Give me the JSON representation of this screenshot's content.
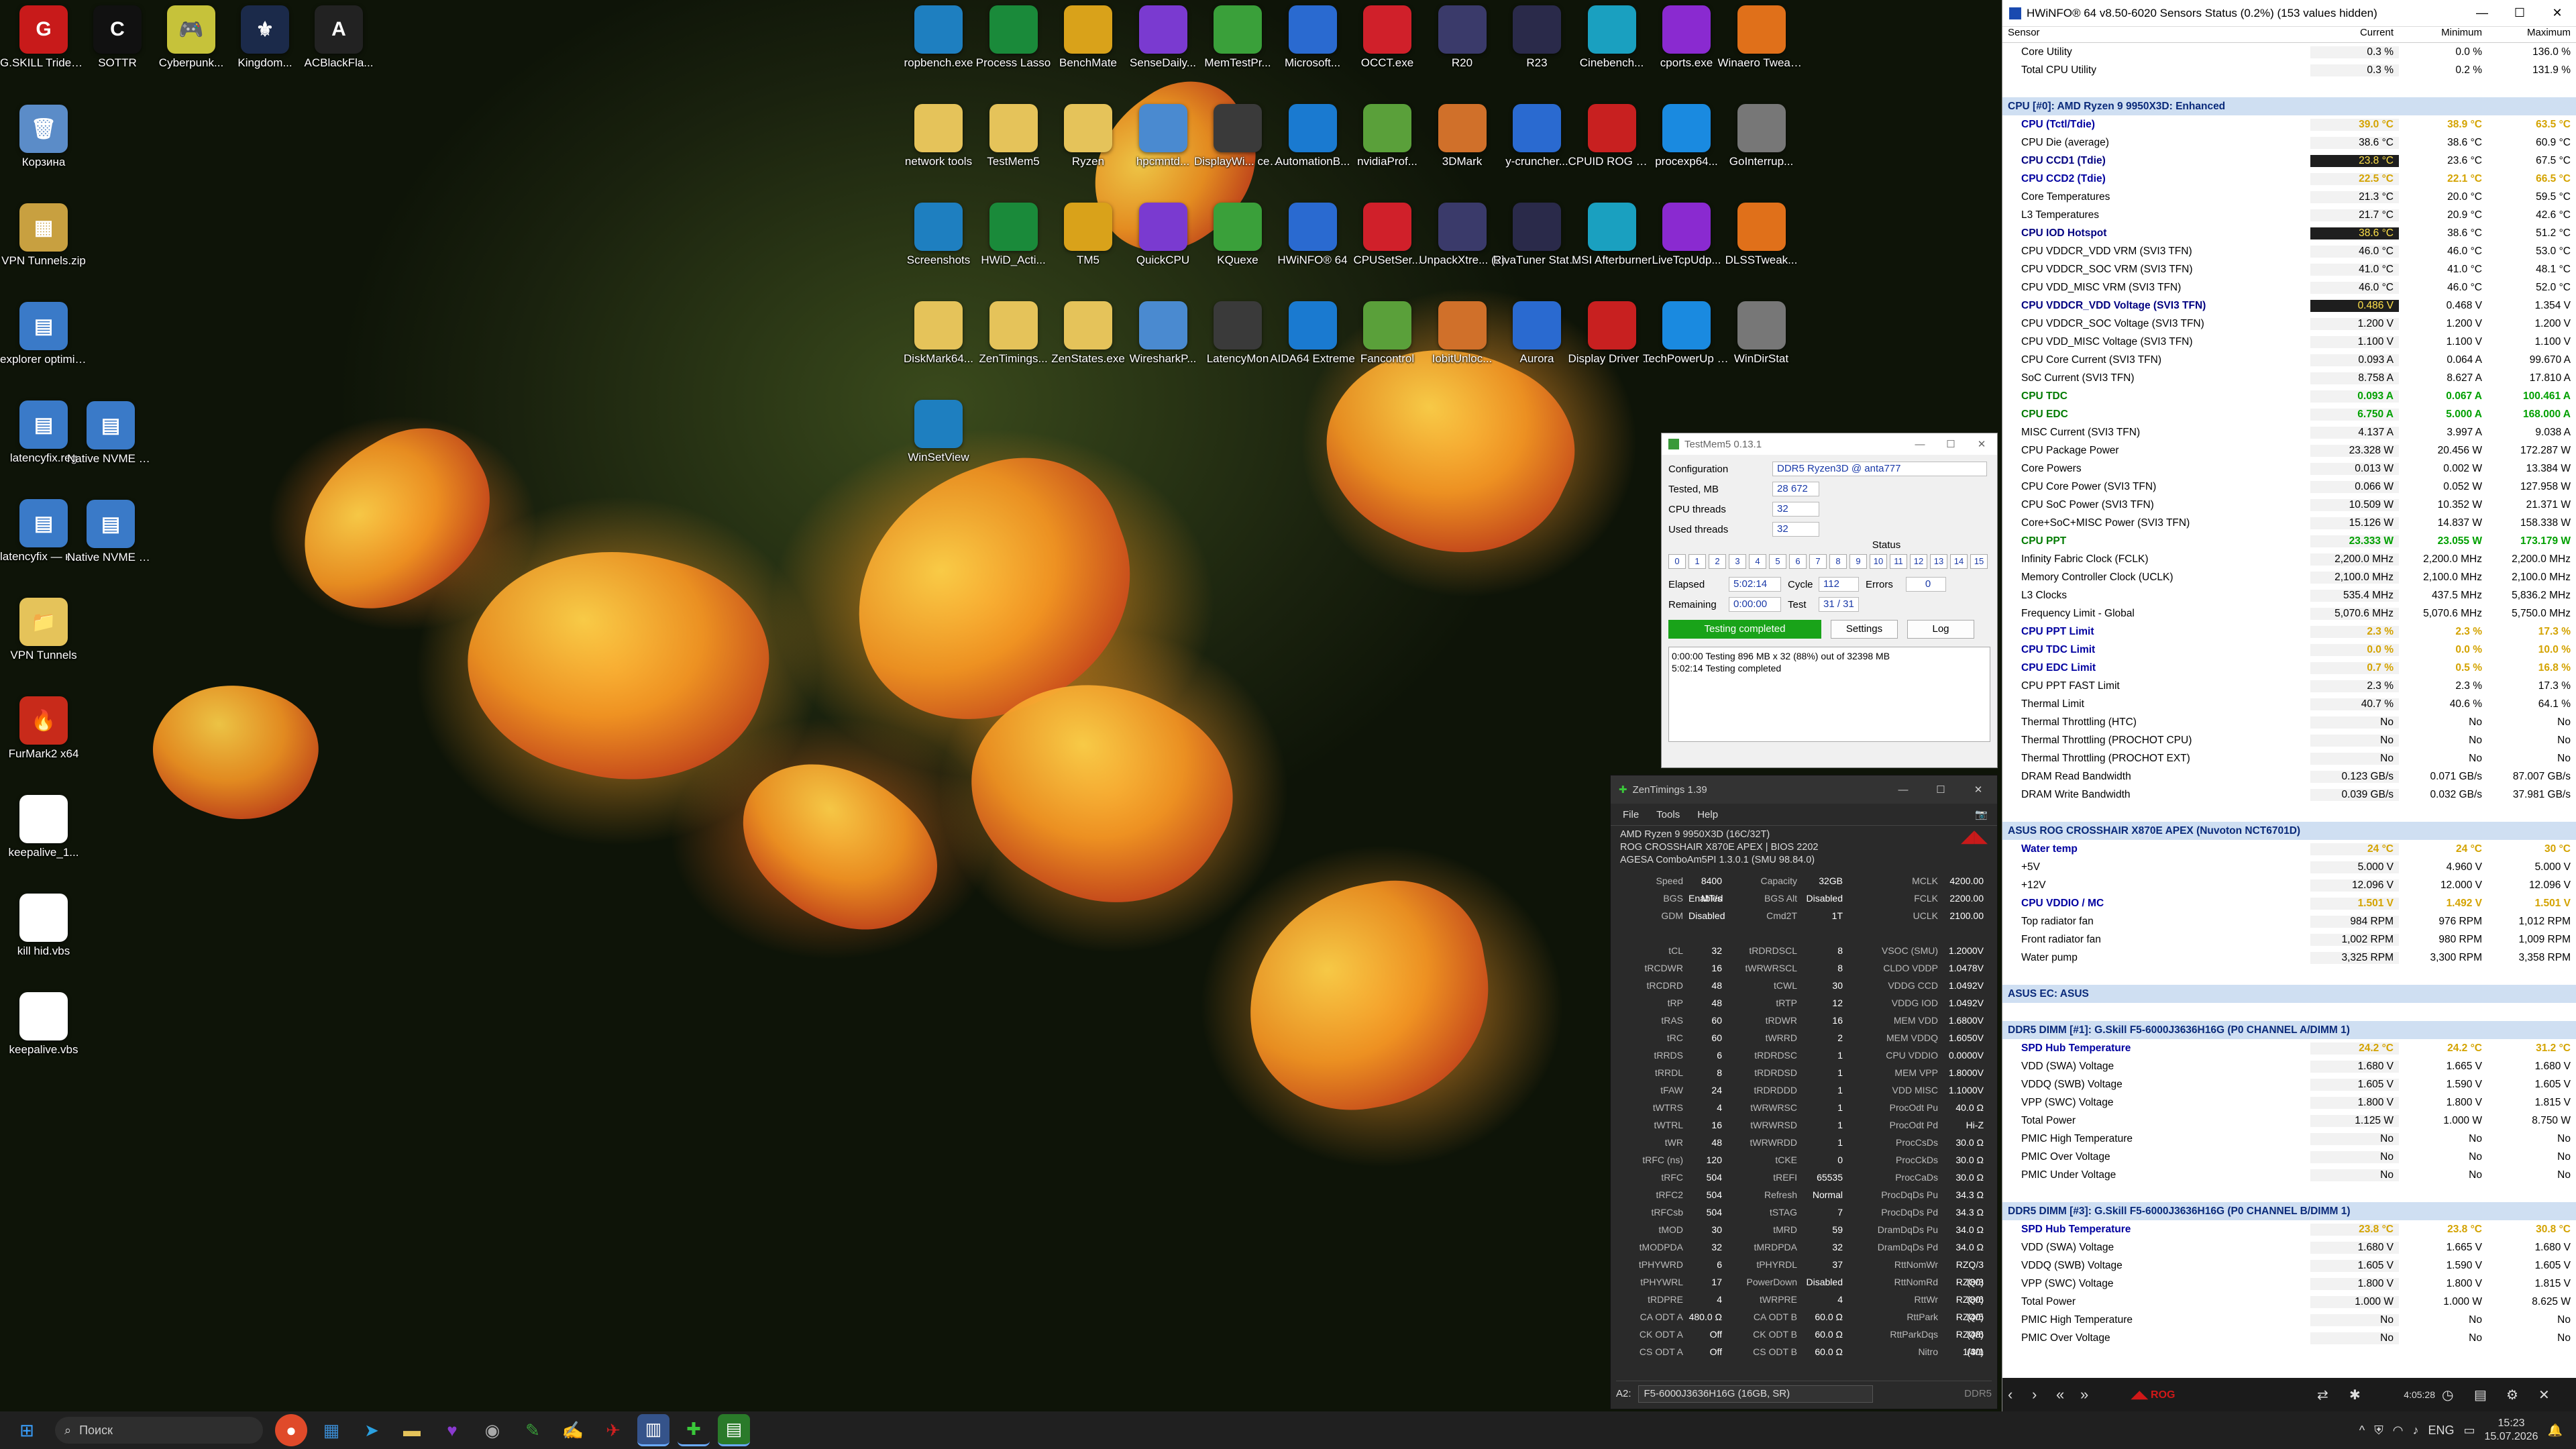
{
  "desktop": {
    "left_icons": [
      {
        "label": "G.SKILL Trident...",
        "glyph": "G",
        "color": "#c81a1a"
      },
      {
        "label": "SOTTR",
        "glyph": "C",
        "color": "#111"
      },
      {
        "label": "Cyberpunk...",
        "glyph": "🎮",
        "color": "#c6c23a"
      },
      {
        "label": "Kingdom...",
        "glyph": "⚜",
        "color": "#1b2a4a"
      },
      {
        "label": "ACBlackFla...",
        "glyph": "A",
        "color": "#222"
      }
    ],
    "col_icons": [
      {
        "label": "Корзина",
        "glyph": "🗑",
        "color": "#5b8cc8"
      },
      {
        "label": "VPN Tunnels.zip",
        "glyph": "▦",
        "color": "#c8a040"
      },
      {
        "label": "explorer optimizatio...",
        "glyph": "▤",
        "color": "#3a7ac8"
      },
      {
        "label": "latencyfix.reg",
        "glyph": "▤",
        "color": "#3a7ac8"
      },
      {
        "label": "latencyfix — копия.reg",
        "glyph": "▤",
        "color": "#3a7ac8"
      },
      {
        "label": "VPN Tunnels",
        "glyph": "📁",
        "color": "#e5c35a"
      },
      {
        "label": "FurMark2 x64",
        "glyph": "🔥",
        "color": "#c82a1a"
      },
      {
        "label": "keepalive_1...",
        "glyph": "S",
        "color": "#ffffff"
      },
      {
        "label": "kill hid.vbs",
        "glyph": "S",
        "color": "#ffffff"
      },
      {
        "label": "keepalive.vbs",
        "glyph": "S",
        "color": "#ffffff"
      }
    ],
    "col2_icons": [
      {
        "label": "Native NVME support — ...",
        "glyph": "▤",
        "color": "#3a7ac8"
      },
      {
        "label": "Native NVME support.reg",
        "glyph": "▤",
        "color": "#3a7ac8"
      }
    ],
    "grid_icons": [
      [
        "ropbench.exe",
        "Process Lasso",
        "BenchMate",
        "SenseDaily...",
        "MemTestPr...",
        "Microsoft...",
        "OCCT.exe",
        "R20",
        "R23",
        "Cinebench...",
        "cports.exe",
        "Winaero Tweaker"
      ],
      [
        "network tools",
        "TestMem5",
        "Ryzen",
        "hpcmntd...",
        "DisplayWi... center",
        "AutomationB...",
        "nvidiaProf...",
        "3DMark",
        "y-cruncher...",
        "CPUID ROG CPU-Z",
        "procexp64...",
        "GoInterrup..."
      ],
      [
        "Screenshots",
        "HWiD_Acti...",
        "TM5",
        "QuickCPU",
        "KQuexe",
        "HWiNFO® 64",
        "CPUSetSer...",
        "UnpackXtre... (2)",
        "RivaTuner Statistic...",
        "MSI Afterburner",
        "LiveTcpUdp...",
        "DLSSTweak..."
      ],
      [
        "DiskMark64...",
        "ZenTimings...",
        "ZenStates.exe",
        "WiresharkP...",
        "LatencyMon",
        "AIDA64 Extreme",
        "Fancontrol",
        "IobitUnloc...",
        "Aurora",
        "Display Driver U...",
        "TechPowerUp GPU-Z",
        "WinDirStat"
      ],
      [
        "WinSetView"
      ]
    ],
    "grid_colors": [
      "#1e7fc0",
      "#1a8a3a",
      "#d9a21a",
      "#7a3ad0",
      "#3aa03a",
      "#2a6ad0",
      "#d0202a",
      "#3a3a6a",
      "#2a2a4a",
      "#1aa0c0",
      "#8a2ad0",
      "#e0701a",
      "#e5c35a",
      "#e5c35a",
      "#e5c35a",
      "#4a8ad0",
      "#3a3a3a",
      "#1a7ad0",
      "#5aa03a",
      "#d0702a",
      "#2a6ad0",
      "#c82020",
      "#1a8ae0",
      "#777"
    ]
  },
  "hwinfo": {
    "title": "HWiNFO® 64 v8.50-6020 Sensors Status (0.2%) (153 values hidden)",
    "headers": [
      "Sensor",
      "Current",
      "Minimum",
      "Maximum"
    ],
    "rows": [
      {
        "t": "",
        "n": "Core Utility",
        "c": "0.3 %",
        "mi": "0.0 %",
        "ma": "136.0 %"
      },
      {
        "t": "",
        "n": "Total CPU Utility",
        "c": "0.3 %",
        "mi": "0.2 %",
        "ma": "131.9 %"
      },
      {
        "t": "blank",
        "n": "",
        "c": "",
        "mi": "",
        "ma": ""
      },
      {
        "t": "grp",
        "n": "CPU [#0]: AMD Ryzen 9 9950X3D: Enhanced",
        "c": "",
        "mi": "",
        "ma": ""
      },
      {
        "t": "yl",
        "n": "CPU (Tctl/Tdie)",
        "c": "39.0 °C",
        "mi": "38.9 °C",
        "ma": "63.5 °C"
      },
      {
        "t": "",
        "n": "CPU Die (average)",
        "c": "38.6 °C",
        "mi": "38.6 °C",
        "ma": "60.9 °C"
      },
      {
        "t": "hl",
        "n": "CPU CCD1 (Tdie)",
        "c": "23.8 °C",
        "mi": "23.6 °C",
        "ma": "67.5 °C"
      },
      {
        "t": "yl",
        "n": "CPU CCD2 (Tdie)",
        "c": "22.5 °C",
        "mi": "22.1 °C",
        "ma": "66.5 °C"
      },
      {
        "t": "",
        "n": "Core Temperatures",
        "c": "21.3 °C",
        "mi": "20.0 °C",
        "ma": "59.5 °C"
      },
      {
        "t": "",
        "n": "L3 Temperatures",
        "c": "21.7 °C",
        "mi": "20.9 °C",
        "ma": "42.6 °C"
      },
      {
        "t": "hl",
        "n": "CPU IOD Hotspot",
        "c": "38.6 °C",
        "mi": "38.6 °C",
        "ma": "51.2 °C"
      },
      {
        "t": "",
        "n": "CPU VDDCR_VDD VRM (SVI3 TFN)",
        "c": "46.0 °C",
        "mi": "46.0 °C",
        "ma": "53.0 °C"
      },
      {
        "t": "",
        "n": "CPU VDDCR_SOC VRM (SVI3 TFN)",
        "c": "41.0 °C",
        "mi": "41.0 °C",
        "ma": "48.1 °C"
      },
      {
        "t": "",
        "n": "CPU VDD_MISC VRM (SVI3 TFN)",
        "c": "46.0 °C",
        "mi": "46.0 °C",
        "ma": "52.0 °C"
      },
      {
        "t": "hl",
        "n": "CPU VDDCR_VDD Voltage (SVI3 TFN)",
        "c": "0.486 V",
        "mi": "0.468 V",
        "ma": "1.354 V"
      },
      {
        "t": "",
        "n": "CPU VDDCR_SOC Voltage (SVI3 TFN)",
        "c": "1.200 V",
        "mi": "1.200 V",
        "ma": "1.200 V"
      },
      {
        "t": "",
        "n": "CPU VDD_MISC Voltage (SVI3 TFN)",
        "c": "1.100 V",
        "mi": "1.100 V",
        "ma": "1.100 V"
      },
      {
        "t": "",
        "n": "CPU Core Current (SVI3 TFN)",
        "c": "0.093 A",
        "mi": "0.064 A",
        "ma": "99.670 A"
      },
      {
        "t": "",
        "n": "SoC Current (SVI3 TFN)",
        "c": "8.758 A",
        "mi": "8.627 A",
        "ma": "17.810 A"
      },
      {
        "t": "gr",
        "n": "CPU TDC",
        "c": "0.093 A",
        "mi": "0.067 A",
        "ma": "100.461 A"
      },
      {
        "t": "gr",
        "n": "CPU EDC",
        "c": "6.750 A",
        "mi": "5.000 A",
        "ma": "168.000 A"
      },
      {
        "t": "",
        "n": "MISC Current (SVI3 TFN)",
        "c": "4.137 A",
        "mi": "3.997 A",
        "ma": "9.038 A"
      },
      {
        "t": "",
        "n": "CPU Package Power",
        "c": "23.328 W",
        "mi": "20.456 W",
        "ma": "172.287 W"
      },
      {
        "t": "",
        "n": "Core Powers",
        "c": "0.013 W",
        "mi": "0.002 W",
        "ma": "13.384 W"
      },
      {
        "t": "",
        "n": "CPU Core Power (SVI3 TFN)",
        "c": "0.066 W",
        "mi": "0.052 W",
        "ma": "127.958 W"
      },
      {
        "t": "",
        "n": "CPU SoC Power (SVI3 TFN)",
        "c": "10.509 W",
        "mi": "10.352 W",
        "ma": "21.371 W"
      },
      {
        "t": "",
        "n": "Core+SoC+MISC Power (SVI3 TFN)",
        "c": "15.126 W",
        "mi": "14.837 W",
        "ma": "158.338 W"
      },
      {
        "t": "gr",
        "n": "CPU PPT",
        "c": "23.333 W",
        "mi": "23.055 W",
        "ma": "173.179 W"
      },
      {
        "t": "",
        "n": "Infinity Fabric Clock (FCLK)",
        "c": "2,200.0 MHz",
        "mi": "2,200.0 MHz",
        "ma": "2,200.0 MHz"
      },
      {
        "t": "",
        "n": "Memory Controller Clock (UCLK)",
        "c": "2,100.0 MHz",
        "mi": "2,100.0 MHz",
        "ma": "2,100.0 MHz"
      },
      {
        "t": "",
        "n": "L3 Clocks",
        "c": "535.4 MHz",
        "mi": "437.5 MHz",
        "ma": "5,836.2 MHz"
      },
      {
        "t": "",
        "n": "Frequency Limit - Global",
        "c": "5,070.6 MHz",
        "mi": "5,070.6 MHz",
        "ma": "5,750.0 MHz"
      },
      {
        "t": "yl",
        "n": "CPU PPT Limit",
        "c": "2.3 %",
        "mi": "2.3 %",
        "ma": "17.3 %"
      },
      {
        "t": "yl",
        "n": "CPU TDC Limit",
        "c": "0.0 %",
        "mi": "0.0 %",
        "ma": "10.0 %"
      },
      {
        "t": "yl",
        "n": "CPU EDC Limit",
        "c": "0.7 %",
        "mi": "0.5 %",
        "ma": "16.8 %"
      },
      {
        "t": "",
        "n": "CPU PPT FAST Limit",
        "c": "2.3 %",
        "mi": "2.3 %",
        "ma": "17.3 %"
      },
      {
        "t": "",
        "n": "Thermal Limit",
        "c": "40.7 %",
        "mi": "40.6 %",
        "ma": "64.1 %"
      },
      {
        "t": "",
        "n": "Thermal Throttling (HTC)",
        "c": "No",
        "mi": "No",
        "ma": "No"
      },
      {
        "t": "",
        "n": "Thermal Throttling (PROCHOT CPU)",
        "c": "No",
        "mi": "No",
        "ma": "No"
      },
      {
        "t": "",
        "n": "Thermal Throttling (PROCHOT EXT)",
        "c": "No",
        "mi": "No",
        "ma": "No"
      },
      {
        "t": "",
        "n": "DRAM Read Bandwidth",
        "c": "0.123 GB/s",
        "mi": "0.071 GB/s",
        "ma": "87.007 GB/s"
      },
      {
        "t": "",
        "n": "DRAM Write Bandwidth",
        "c": "0.039 GB/s",
        "mi": "0.032 GB/s",
        "ma": "37.981 GB/s"
      },
      {
        "t": "blank",
        "n": "",
        "c": "",
        "mi": "",
        "ma": ""
      },
      {
        "t": "grp",
        "n": "ASUS ROG CROSSHAIR X870E APEX (Nuvoton NCT6701D)",
        "c": "",
        "mi": "",
        "ma": ""
      },
      {
        "t": "yl",
        "n": "Water temp",
        "c": "24 °C",
        "mi": "24 °C",
        "ma": "30 °C"
      },
      {
        "t": "",
        "n": "+5V",
        "c": "5.000 V",
        "mi": "4.960 V",
        "ma": "5.000 V"
      },
      {
        "t": "",
        "n": "+12V",
        "c": "12.096 V",
        "mi": "12.000 V",
        "ma": "12.096 V"
      },
      {
        "t": "yl",
        "n": "CPU VDDIO / MC",
        "c": "1.501 V",
        "mi": "1.492 V",
        "ma": "1.501 V"
      },
      {
        "t": "",
        "n": "Top radiator fan",
        "c": "984 RPM",
        "mi": "976 RPM",
        "ma": "1,012 RPM"
      },
      {
        "t": "",
        "n": "Front radiator fan",
        "c": "1,002 RPM",
        "mi": "980 RPM",
        "ma": "1,009 RPM"
      },
      {
        "t": "",
        "n": "Water pump",
        "c": "3,325 RPM",
        "mi": "3,300 RPM",
        "ma": "3,358 RPM"
      },
      {
        "t": "blank",
        "n": "",
        "c": "",
        "mi": "",
        "ma": ""
      },
      {
        "t": "grp",
        "n": "ASUS EC: ASUS",
        "c": "",
        "mi": "",
        "ma": ""
      },
      {
        "t": "blank",
        "n": "",
        "c": "",
        "mi": "",
        "ma": ""
      },
      {
        "t": "grp",
        "n": "DDR5 DIMM [#1]: G.Skill F5-6000J3636H16G (P0 CHANNEL A/DIMM 1)",
        "c": "",
        "mi": "",
        "ma": ""
      },
      {
        "t": "yl",
        "n": "SPD Hub Temperature",
        "c": "24.2 °C",
        "mi": "24.2 °C",
        "ma": "31.2 °C"
      },
      {
        "t": "",
        "n": "VDD (SWA) Voltage",
        "c": "1.680 V",
        "mi": "1.665 V",
        "ma": "1.680 V"
      },
      {
        "t": "",
        "n": "VDDQ (SWB) Voltage",
        "c": "1.605 V",
        "mi": "1.590 V",
        "ma": "1.605 V"
      },
      {
        "t": "",
        "n": "VPP (SWC) Voltage",
        "c": "1.800 V",
        "mi": "1.800 V",
        "ma": "1.815 V"
      },
      {
        "t": "",
        "n": "Total Power",
        "c": "1.125 W",
        "mi": "1.000 W",
        "ma": "8.750 W"
      },
      {
        "t": "",
        "n": "PMIC High Temperature",
        "c": "No",
        "mi": "No",
        "ma": "No"
      },
      {
        "t": "",
        "n": "PMIC Over Voltage",
        "c": "No",
        "mi": "No",
        "ma": "No"
      },
      {
        "t": "",
        "n": "PMIC Under Voltage",
        "c": "No",
        "mi": "No",
        "ma": "No"
      },
      {
        "t": "blank",
        "n": "",
        "c": "",
        "mi": "",
        "ma": ""
      },
      {
        "t": "grp",
        "n": "DDR5 DIMM [#3]: G.Skill F5-6000J3636H16G (P0 CHANNEL B/DIMM 1)",
        "c": "",
        "mi": "",
        "ma": ""
      },
      {
        "t": "yl",
        "n": "SPD Hub Temperature",
        "c": "23.8 °C",
        "mi": "23.8 °C",
        "ma": "30.8 °C"
      },
      {
        "t": "",
        "n": "VDD (SWA) Voltage",
        "c": "1.680 V",
        "mi": "1.665 V",
        "ma": "1.680 V"
      },
      {
        "t": "",
        "n": "VDDQ (SWB) Voltage",
        "c": "1.605 V",
        "mi": "1.590 V",
        "ma": "1.605 V"
      },
      {
        "t": "",
        "n": "VPP (SWC) Voltage",
        "c": "1.800 V",
        "mi": "1.800 V",
        "ma": "1.815 V"
      },
      {
        "t": "",
        "n": "Total Power",
        "c": "1.000 W",
        "mi": "1.000 W",
        "ma": "8.625 W"
      },
      {
        "t": "",
        "n": "PMIC High Temperature",
        "c": "No",
        "mi": "No",
        "ma": "No"
      },
      {
        "t": "",
        "n": "PMIC Over Voltage",
        "c": "No",
        "mi": "No",
        "ma": "No"
      }
    ],
    "footer_time": "4:05:28"
  },
  "testmem": {
    "title": "TestMem5  0.13.1",
    "config_label": "Configuration",
    "config": "DDR5 Ryzen3D @ anta777",
    "tested_label": "Tested, MB",
    "tested": "28 672",
    "cpu_label": "CPU threads",
    "cpu": "32",
    "used_label": "Used threads",
    "used": "32",
    "status_label": "Status",
    "threads": [
      "0",
      "1",
      "2",
      "3",
      "4",
      "5",
      "6",
      "7",
      "8",
      "9",
      "10",
      "11",
      "12",
      "13",
      "14",
      "15"
    ],
    "elapsed_label": "Elapsed",
    "elapsed": "5:02:14",
    "cycle_label": "Cycle",
    "cycle": "112",
    "errors_label": "Errors",
    "errors": "0",
    "remaining_label": "Remaining",
    "remaining": "0:00:00",
    "test_label": "Test",
    "test": "31 / 31",
    "status": "Testing completed",
    "settings": "Settings",
    "log": "Log",
    "log_line1": "0:00:00  Testing 896 MB x 32 (88%) out of 32398 MB",
    "log_line2": "5:02:14  Testing completed"
  },
  "zentimings": {
    "title": "ZenTimings 1.39",
    "menu": [
      "File",
      "Tools",
      "Help"
    ],
    "info1": "AMD Ryzen 9 9950X3D (16C/32T)",
    "info2": "ROG CROSSHAIR X870E APEX | BIOS 2202",
    "info3": "AGESA ComboAm5PI 1.3.0.1 (SMU 98.84.0)",
    "grid": [
      [
        "Speed",
        "8400 MT/s",
        "Capacity",
        "32GB",
        "MCLK",
        "4200.00"
      ],
      [
        "BGS",
        "Enabled",
        "BGS Alt",
        "Disabled",
        "FCLK",
        "2200.00"
      ],
      [
        "GDM",
        "Disabled",
        "Cmd2T",
        "1T",
        "UCLK",
        "2100.00"
      ],
      [
        "",
        "",
        "",
        "",
        "",
        ""
      ],
      [
        "tCL",
        "32",
        "tRDRDSCL",
        "8",
        "VSOC (SMU)",
        "1.2000V"
      ],
      [
        "tRCDWR",
        "16",
        "tWRWRSCL",
        "8",
        "CLDO VDDP",
        "1.0478V"
      ],
      [
        "tRCDRD",
        "48",
        "tCWL",
        "30",
        "VDDG CCD",
        "1.0492V"
      ],
      [
        "tRP",
        "48",
        "tRTP",
        "12",
        "VDDG IOD",
        "1.0492V"
      ],
      [
        "tRAS",
        "60",
        "tRDWR",
        "16",
        "MEM VDD",
        "1.6800V"
      ],
      [
        "tRC",
        "60",
        "tWRRD",
        "2",
        "MEM VDDQ",
        "1.6050V"
      ],
      [
        "tRRDS",
        "6",
        "tRDRDSC",
        "1",
        "CPU VDDIO",
        "0.0000V"
      ],
      [
        "tRRDL",
        "8",
        "tRDRDSD",
        "1",
        "MEM VPP",
        "1.8000V"
      ],
      [
        "tFAW",
        "24",
        "tRDRDDD",
        "1",
        "VDD MISC",
        "1.1000V"
      ],
      [
        "tWTRS",
        "4",
        "tWRWRSC",
        "1",
        "ProcOdt Pu",
        "40.0 Ω"
      ],
      [
        "tWTRL",
        "16",
        "tWRWRSD",
        "1",
        "ProcOdt Pd",
        "Hi-Z"
      ],
      [
        "tWR",
        "48",
        "tWRWRDD",
        "1",
        "ProcCsDs",
        "30.0 Ω"
      ],
      [
        "tRFC (ns)",
        "120",
        "tCKE",
        "0",
        "ProcCkDs",
        "30.0 Ω"
      ],
      [
        "tRFC",
        "504",
        "tREFI",
        "65535",
        "ProcCaDs",
        "30.0 Ω"
      ],
      [
        "tRFC2",
        "504",
        "Refresh",
        "Normal",
        "ProcDqDs Pu",
        "34.3 Ω"
      ],
      [
        "tRFCsb",
        "504",
        "tSTAG",
        "7",
        "ProcDqDs Pd",
        "34.3 Ω"
      ],
      [
        "tMOD",
        "30",
        "tMRD",
        "59",
        "DramDqDs Pu",
        "34.0 Ω"
      ],
      [
        "tMODPDA",
        "32",
        "tMRDPDA",
        "32",
        "DramDqDs Pd",
        "34.0 Ω"
      ],
      [
        "tPHYWRD",
        "6",
        "tPHYRDL",
        "37",
        "RttNomWr",
        "RZQ/3 (80)"
      ],
      [
        "tPHYWRL",
        "17",
        "PowerDown",
        "Disabled",
        "RttNomRd",
        "RZQ/3 (80)"
      ],
      [
        "tRDPRE",
        "4",
        "tWRPRE",
        "4",
        "RttWr",
        "RZQ/6 (40)"
      ],
      [
        "CA ODT A",
        "480.0 Ω",
        "CA ODT B",
        "60.0 Ω",
        "RttPark",
        "RZQ/5 (48)"
      ],
      [
        "CK ODT A",
        "Off",
        "CK ODT B",
        "60.0 Ω",
        "RttParkDqs",
        "RZQ/6 (40)"
      ],
      [
        "CS ODT A",
        "Off",
        "CS ODT B",
        "60.0 Ω",
        "Nitro",
        "1/3/1"
      ]
    ],
    "slot": "A2:",
    "module": "F5-6000J3636H16G (16GB, SR)",
    "type": "DDR5"
  },
  "taskbar": {
    "search_placeholder": "Поиск",
    "lang": "ENG",
    "time": "15:23",
    "date": "15.07.2026"
  }
}
